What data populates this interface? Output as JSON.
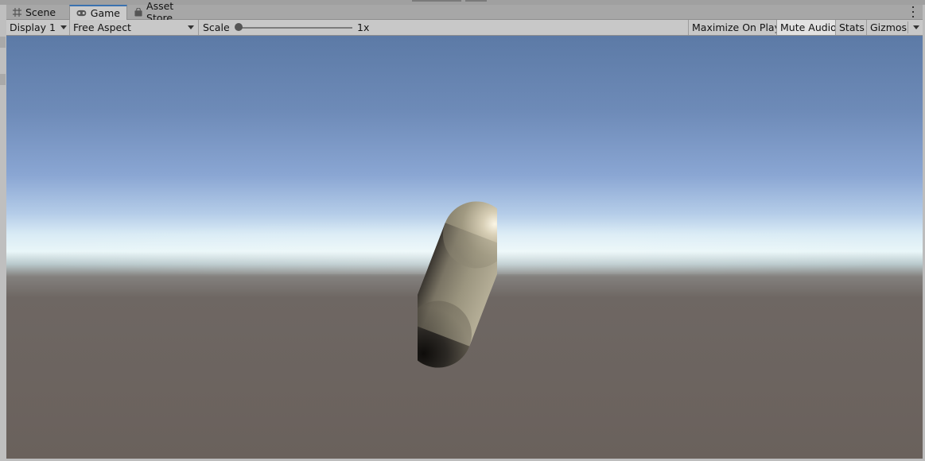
{
  "tabs": [
    {
      "label": "Scene",
      "icon": "grid-icon",
      "active": false
    },
    {
      "label": "Game",
      "icon": "gamepad-icon",
      "active": true
    },
    {
      "label": "Asset Store",
      "icon": "bag-icon",
      "active": false
    }
  ],
  "toolbar": {
    "display_label": "Display 1",
    "aspect_label": "Free Aspect",
    "scale_label": "Scale",
    "scale_value": "1x",
    "scale_fraction": 0.0,
    "maximize_label": "Maximize On Play",
    "mute_label": "Mute Audio",
    "mute_active": true,
    "stats_label": "Stats",
    "gizmos_label": "Gizmos"
  },
  "viewport": {
    "sky_color": "#6e8bb8",
    "horizon_color": "#e9f6f8",
    "ground_color": "#6a615c",
    "object": "capsule"
  },
  "colors": {
    "active_tab_accent": "#3a72b0"
  }
}
